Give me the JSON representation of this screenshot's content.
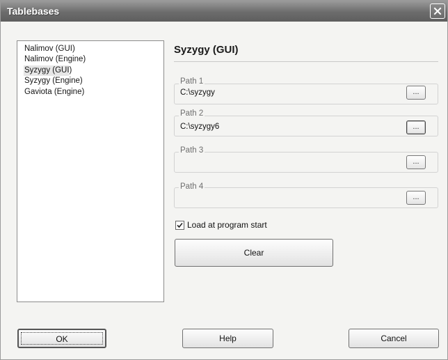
{
  "window": {
    "title": "Tablebases"
  },
  "list": {
    "items": [
      {
        "label": "Nalimov (GUI)"
      },
      {
        "label": "Nalimov (Engine)"
      },
      {
        "label": "Syzygy (GUI)"
      },
      {
        "label": "Syzygy (Engine)"
      },
      {
        "label": "Gaviota (Engine)"
      }
    ],
    "selected_index": 2
  },
  "panel": {
    "title": "Syzygy (GUI)",
    "paths": [
      {
        "label": "Path 1",
        "value": "C:\\syzygy",
        "browse_label": "..."
      },
      {
        "label": "Path 2",
        "value": "C:\\syzygy6",
        "browse_label": "..."
      },
      {
        "label": "Path 3",
        "value": "",
        "browse_label": "..."
      },
      {
        "label": "Path 4",
        "value": "",
        "browse_label": "..."
      }
    ],
    "load_at_start": {
      "label": "Load at program start",
      "checked": true
    },
    "clear_label": "Clear"
  },
  "footer": {
    "ok_label": "OK",
    "help_label": "Help",
    "cancel_label": "Cancel"
  },
  "colors": {
    "titlebar": "#6c6c6c",
    "window_bg": "#f4f4f2",
    "list_bg": "#ffffff",
    "selection": "#e6e6e6"
  }
}
